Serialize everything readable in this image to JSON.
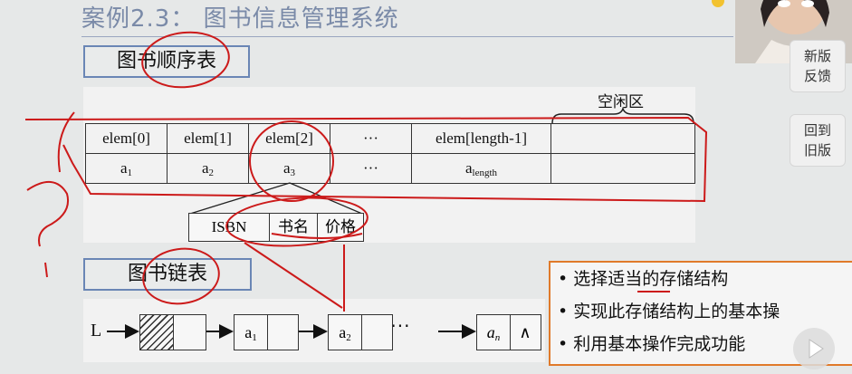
{
  "slide": {
    "title": "案例2.3： 图书信息管理系统",
    "seq_label": "图书顺序表",
    "link_label": "图书链表",
    "free_zone_label": "空闲区"
  },
  "seq_table": {
    "row1": [
      "elem[0]",
      "elem[1]",
      "elem[2]",
      "···",
      "elem[length-1]",
      ""
    ],
    "row2": [
      {
        "base": "a",
        "sub": "1"
      },
      {
        "base": "a",
        "sub": "2"
      },
      {
        "base": "a",
        "sub": "3"
      },
      {
        "base": "···",
        "sub": ""
      },
      {
        "base": "a",
        "sub": "length"
      },
      {
        "base": "",
        "sub": ""
      }
    ]
  },
  "record_fields": [
    "ISBN",
    "书名",
    "价格"
  ],
  "linked_list": {
    "head_label": "L",
    "node1": {
      "base": "a",
      "sub": "1"
    },
    "node2": {
      "base": "a",
      "sub": "2"
    },
    "ellipsis": "····",
    "noden": {
      "base": "a",
      "sub": "n"
    },
    "null_symbol": "∧"
  },
  "bullets": {
    "marker": "•",
    "items": [
      "选择适当的存储结构",
      "实现此存储结构上的基本操",
      "利用基本操作完成功能"
    ]
  },
  "side_buttons": {
    "new_feedback_line1": "新版",
    "new_feedback_line2": "反馈",
    "old_version_line1": "回到",
    "old_version_line2": "旧版"
  },
  "annotation_colors": {
    "pen": "#cc1a1a",
    "bullet_border": "#e07a2a",
    "label_border": "#6a86b5"
  }
}
